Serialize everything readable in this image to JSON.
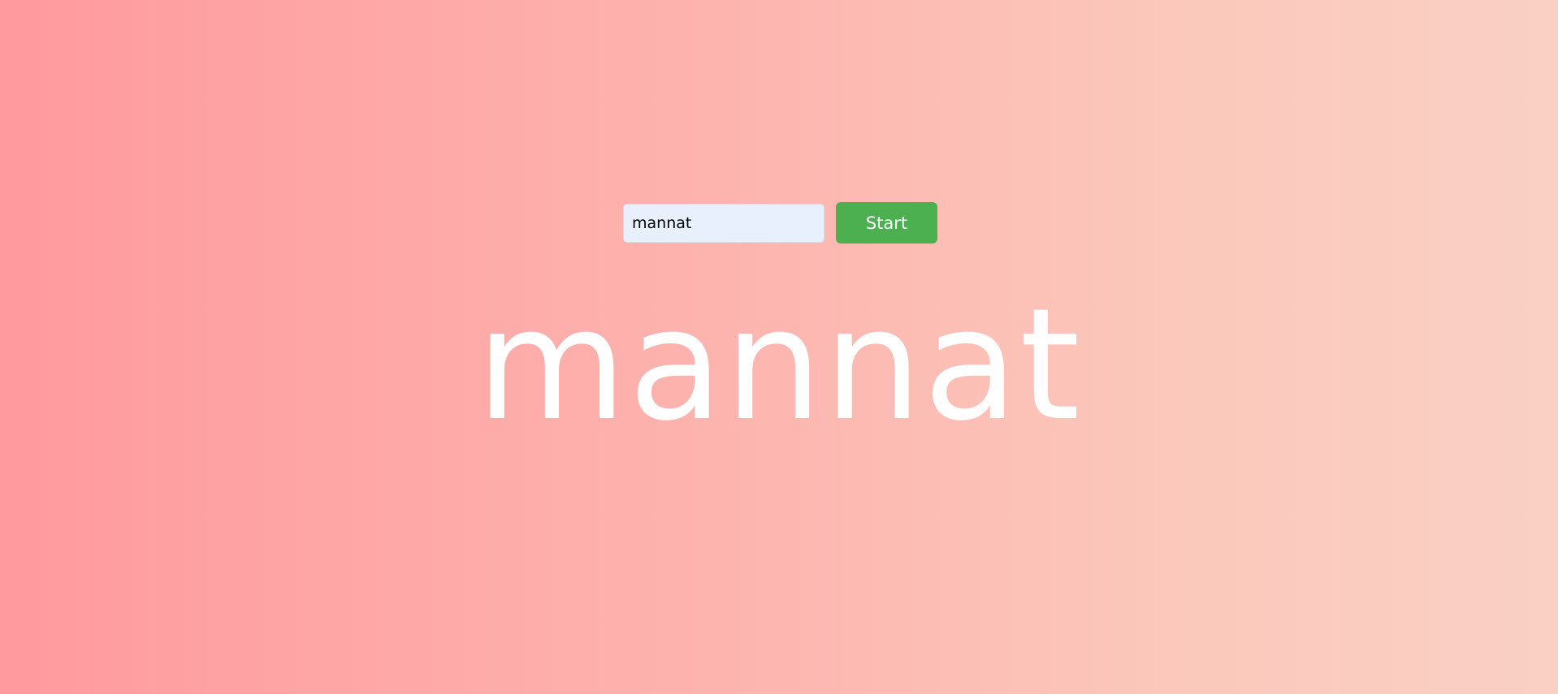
{
  "form": {
    "name_value": "mannat",
    "start_label": "Start"
  },
  "display": {
    "name_text": "mannat"
  },
  "colors": {
    "background_start": "#ff9a9e",
    "background_end": "#fad0c4",
    "button": "#4caf50",
    "input_background": "#e8f0fe",
    "display_text": "#ffffff"
  }
}
